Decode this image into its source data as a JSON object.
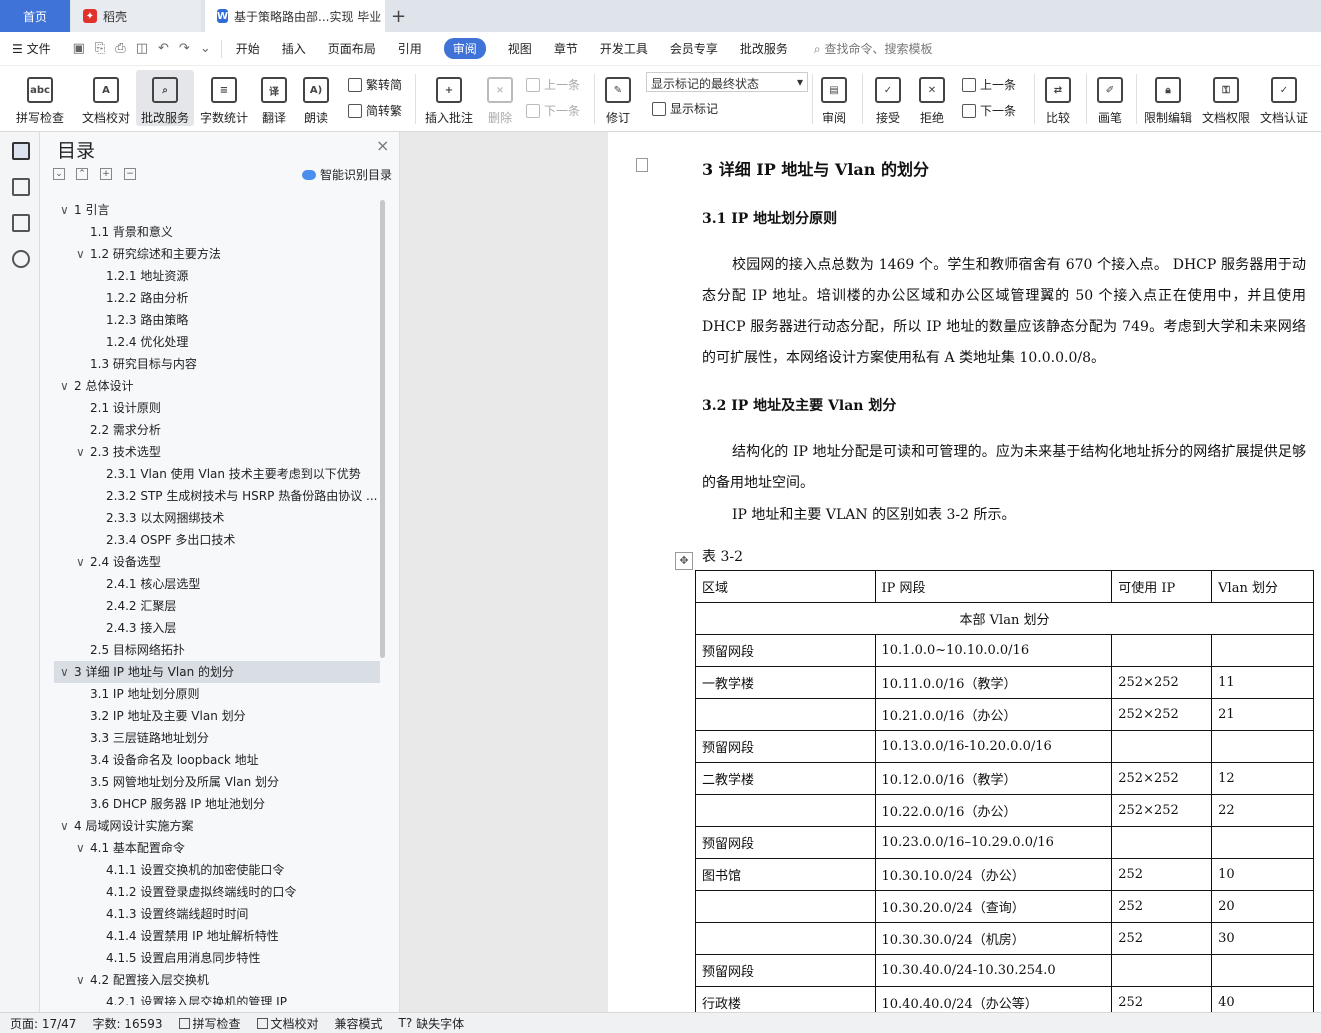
{
  "tabs": {
    "home": "首页",
    "daoke": "稻壳",
    "doc": "基于策略路由部...实现 毕业",
    "add": "+"
  },
  "menu": {
    "file": "文件",
    "items": [
      "开始",
      "插入",
      "页面布局",
      "引用",
      "审阅",
      "视图",
      "章节",
      "开发工具",
      "会员专享",
      "批改服务"
    ],
    "active": "审阅",
    "search": "查找命令、搜索模板"
  },
  "ribbon": {
    "spell": "拼写检查",
    "proof": "文档校对",
    "review_service": "批改服务",
    "word_count": "字数统计",
    "translate": "翻译",
    "read": "朗读",
    "to_trad": "繁转简",
    "to_simp": "简转繁",
    "insert_comment": "插入批注",
    "delete": "删除",
    "prev": "上一条",
    "next": "下一条",
    "track": "修订",
    "markup_mode": "显示标记的最终状态",
    "show_markup": "显示标记",
    "review": "审阅",
    "accept": "接受",
    "reject": "拒绝",
    "prev2": "上一条",
    "next2": "下一条",
    "compare": "比较",
    "pen": "画笔",
    "restrict": "限制编辑",
    "permission": "文档权限",
    "certify": "文档认证"
  },
  "toc": {
    "title": "目录",
    "close": "×",
    "smart": "智能识别目录",
    "items": [
      {
        "level": 1,
        "text": "1 引言",
        "expand": true
      },
      {
        "level": 2,
        "text": "1.1 背景和意义"
      },
      {
        "level": 2,
        "text": "1.2 研究综述和主要方法",
        "expand": true
      },
      {
        "level": 3,
        "text": "1.2.1 地址资源"
      },
      {
        "level": 3,
        "text": "1.2.2 路由分析"
      },
      {
        "level": 3,
        "text": "1.2.3 路由策略"
      },
      {
        "level": 3,
        "text": "1.2.4 优化处理"
      },
      {
        "level": 2,
        "text": "1.3 研究目标与内容"
      },
      {
        "level": 1,
        "text": "2 总体设计",
        "expand": true
      },
      {
        "level": 2,
        "text": "2.1 设计原则"
      },
      {
        "level": 2,
        "text": "2.2 需求分析"
      },
      {
        "level": 2,
        "text": "2.3 技术选型",
        "expand": true
      },
      {
        "level": 3,
        "text": "2.3.1 Vlan 使用 Vlan 技术主要考虑到以下优势"
      },
      {
        "level": 3,
        "text": "2.3.2 STP 生成树技术与 HSRP 热备份路由协议 ..."
      },
      {
        "level": 3,
        "text": "2.3.3 以太网捆绑技术"
      },
      {
        "level": 3,
        "text": "2.3.4 OSPF 多出口技术"
      },
      {
        "level": 2,
        "text": "2.4 设备选型",
        "expand": true
      },
      {
        "level": 3,
        "text": "2.4.1 核心层选型"
      },
      {
        "level": 3,
        "text": "2.4.2 汇聚层"
      },
      {
        "level": 3,
        "text": "2.4.3 接入层"
      },
      {
        "level": 2,
        "text": "2.5 目标网络拓扑"
      },
      {
        "level": 1,
        "text": "3 详细 IP 地址与 Vlan 的划分",
        "expand": true,
        "selected": true
      },
      {
        "level": 2,
        "text": "3.1 IP 地址划分原则"
      },
      {
        "level": 2,
        "text": "3.2 IP 地址及主要 Vlan 划分"
      },
      {
        "level": 2,
        "text": "3.3 三层链路地址划分"
      },
      {
        "level": 2,
        "text": "3.4 设备命名及 loopback 地址"
      },
      {
        "level": 2,
        "text": "3.5 网管地址划分及所属 Vlan 划分"
      },
      {
        "level": 2,
        "text": "3.6 DHCP 服务器 IP 地址池划分"
      },
      {
        "level": 1,
        "text": "4 局域网设计实施方案",
        "expand": true
      },
      {
        "level": 2,
        "text": "4.1 基本配置命令",
        "expand": true
      },
      {
        "level": 3,
        "text": "4.1.1 设置交换机的加密使能口令"
      },
      {
        "level": 3,
        "text": "4.1.2 设置登录虚拟终端线时的口令"
      },
      {
        "level": 3,
        "text": "4.1.3 设置终端线超时时间"
      },
      {
        "level": 3,
        "text": "4.1.4 设置禁用 IP 地址解析特性"
      },
      {
        "level": 3,
        "text": "4.1.5 设置启用消息同步特性"
      },
      {
        "level": 2,
        "text": "4.2 配置接入层交换机",
        "expand": true
      },
      {
        "level": 3,
        "text": "4.2.1 设置接入层交换机的管理 IP"
      }
    ]
  },
  "document": {
    "heading": "3 详细 IP 地址与 Vlan 的划分",
    "sec1_title": "3.1 IP 地址划分原则",
    "sec1_para": "校园网的接入点总数为 1469 个。学生和教师宿舍有 670 个接入点。 DHCP 服务器用于动态分配 IP 地址。培训楼的办公区域和办公区域管理翼的 50 个接入点正在使用中，并且使用 DHCP 服务器进行动态分配，所以 IP 地址的数量应该静态分配为 749。考虑到大学和未来网络的可扩展性，本网络设计方案使用私有 A 类地址集 10.0.0.0/8。",
    "sec2_title": "3.2 IP 地址及主要 Vlan 划分",
    "sec2_para1": "结构化的 IP 地址分配是可读和可管理的。应为未来基于结构化地址拆分的网络扩展提供足够的备用地址空间。",
    "sec2_para2": "IP 地址和主要 VLAN 的区别如表 3-2 所示。",
    "table_caption": "表 3-2",
    "table_header": [
      "区域",
      "IP 网段",
      "可使用 IP",
      "Vlan 划分"
    ],
    "table_merged": "本部 Vlan 划分",
    "table_rows": [
      [
        "预留网段",
        "10.1.0.0~10.10.0.0/16",
        "",
        ""
      ],
      [
        "一教学楼",
        "10.11.0.0/16（教学）",
        "252×252",
        "11"
      ],
      [
        "",
        "10.21.0.0/16（办公）",
        "252×252",
        "21"
      ],
      [
        "预留网段",
        "10.13.0.0/16-10.20.0.0/16",
        "",
        ""
      ],
      [
        "二教学楼",
        "10.12.0.0/16（教学）",
        "252×252",
        "12"
      ],
      [
        "",
        "10.22.0.0/16（办公）",
        "252×252",
        "22"
      ],
      [
        "预留网段",
        "10.23.0.0/16–10.29.0.0/16",
        "",
        ""
      ],
      [
        "图书馆",
        "10.30.10.0/24（办公）",
        "252",
        "10"
      ],
      [
        "",
        "10.30.20.0/24（查询）",
        "252",
        "20"
      ],
      [
        "",
        "10.30.30.0/24（机房）",
        "252",
        "30"
      ],
      [
        "预留网段",
        "10.30.40.0/24-10.30.254.0",
        "",
        ""
      ],
      [
        "行政楼",
        "10.40.40.0/24（办公等）",
        "252",
        "40"
      ]
    ]
  },
  "status": {
    "page": "页面: 17/47",
    "words": "字数: 16593",
    "spell": "拼写检查",
    "proof": "文档校对",
    "compat": "兼容模式",
    "missing_font": "缺失字体"
  }
}
